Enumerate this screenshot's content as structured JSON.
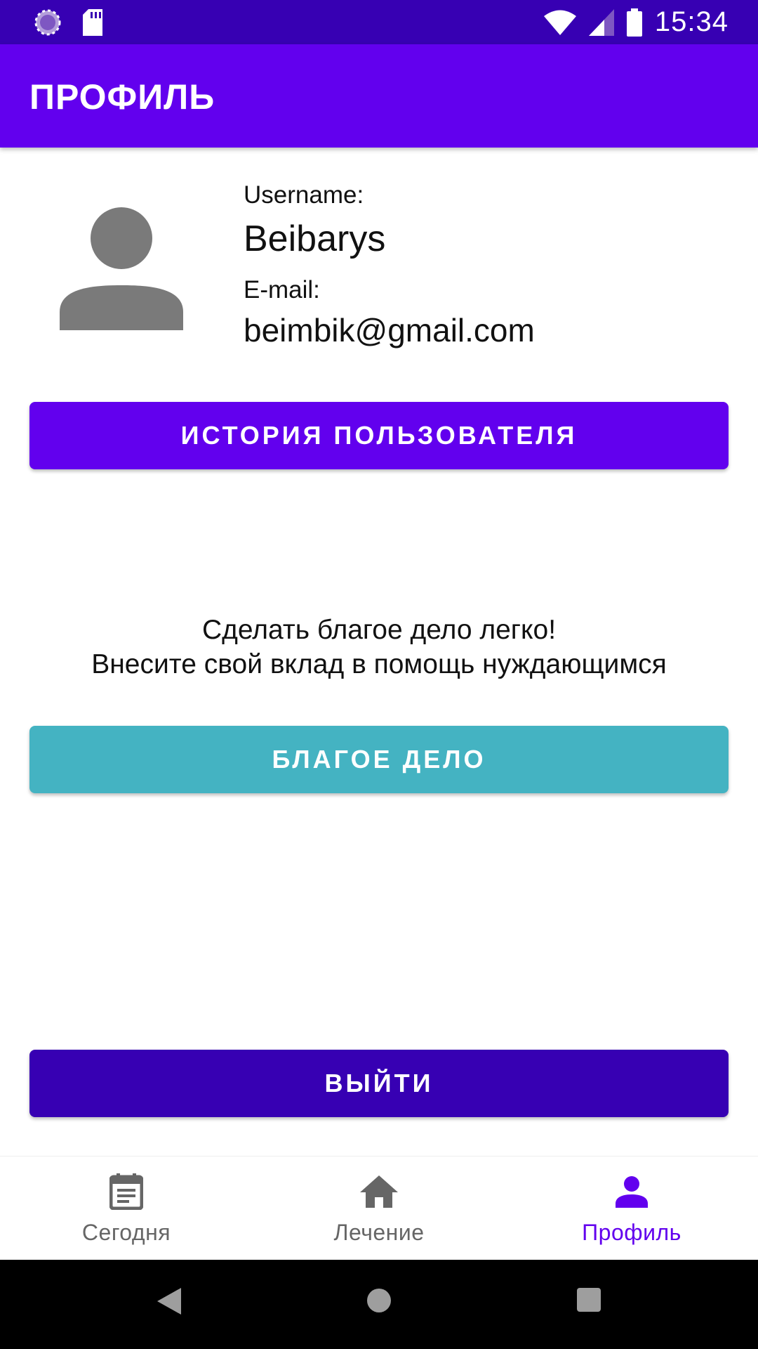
{
  "status_bar": {
    "time": "15:34",
    "icons": [
      "loading-icon",
      "sd-card-icon",
      "wifi-icon",
      "signal-icon",
      "battery-icon"
    ]
  },
  "app_bar": {
    "title": "ПРОФИЛЬ"
  },
  "profile": {
    "avatar_icon": "person-icon",
    "username_label": "Username:",
    "username": "Beibarys",
    "email_label": "E-mail:",
    "email": "beimbik@gmail.com"
  },
  "buttons": {
    "history": "ИСТОРИЯ ПОЛЬЗОВАТЕЛЯ",
    "good_deed": "БЛАГОЕ ДЕЛО",
    "logout": "ВЫЙТИ"
  },
  "promo": {
    "line1": "Сделать благое дело легко!",
    "line2": "Внесите свой вклад в помощь нуждающимся"
  },
  "bottom_nav": {
    "items": [
      {
        "label": "Сегодня",
        "icon": "calendar-icon",
        "active": false
      },
      {
        "label": "Лечение",
        "icon": "home-icon",
        "active": false
      },
      {
        "label": "Профиль",
        "icon": "person-icon",
        "active": true
      }
    ]
  },
  "colors": {
    "status_bar": "#3700b3",
    "primary": "#6200ee",
    "primary_dark": "#3700b3",
    "accent_teal": "#44b3c2",
    "inactive_nav": "#666666"
  }
}
